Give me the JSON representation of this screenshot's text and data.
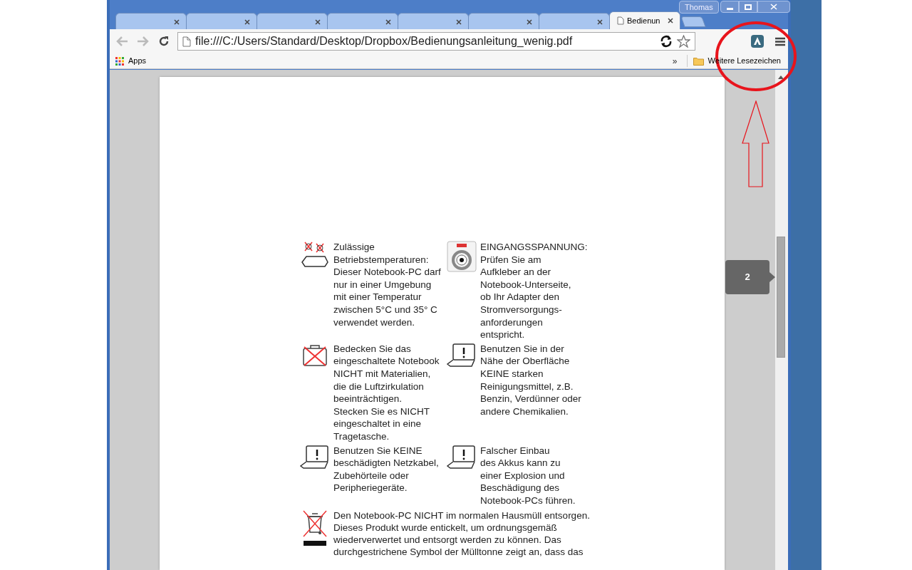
{
  "window": {
    "profile": "Thomas"
  },
  "tabs": [
    {
      "selected": false
    },
    {
      "selected": false
    },
    {
      "selected": false
    },
    {
      "selected": false
    },
    {
      "selected": false
    },
    {
      "selected": false
    },
    {
      "selected": false
    },
    {
      "title": "Bedienun",
      "selected": true
    }
  ],
  "address": "file:///C:/Users/Standard/Desktop/Dropbox/Bedienungsanleitung_wenig.pdf",
  "bookmarks": {
    "apps": "Apps",
    "overflow": "»",
    "other": "Weitere Lesezeichen"
  },
  "document": {
    "items": [
      {
        "kind": "temperature",
        "lines": [
          "Zulässige",
          "Betriebstemperaturen:",
          "Dieser Notebook-PC darf",
          "nur in einer Umgebung",
          "mit einer Temperatur",
          "zwischen 5°C und 35° C",
          "verwendet werden."
        ]
      },
      {
        "kind": "dcin",
        "lines": [
          "EINGANGSSPANNUNG:",
          "Prüfen Sie am",
          "Aufkleber an der",
          "Notebook-Unterseite,",
          "ob Ihr Adapter den",
          "Stromversorgungs-",
          "anforderungen",
          "entspricht."
        ]
      },
      {
        "kind": "bag",
        "lines": [
          "Bedecken Sie das",
          "eingeschaltete Notebook",
          "NICHT mit Materialien,",
          "die die Luftzirkulation",
          "beeinträchtigen.",
          "Stecken Sie es NICHT",
          "eingeschaltet in eine",
          "Tragetasche."
        ]
      },
      {
        "kind": "laptop",
        "lines": [
          "Benutzen Sie in der",
          "Nähe der Oberfläche",
          "KEINE starken",
          "Reinigungsmittel, z.B.",
          "Benzin, Verdünner oder",
          "andere Chemikalien."
        ]
      },
      {
        "kind": "laptop",
        "lines": [
          "Benutzen Sie KEINE",
          "beschädigten Netzkabel,",
          "Zubehörteile oder",
          "Peripheriegeräte."
        ]
      },
      {
        "kind": "laptop",
        "lines": [
          "Falscher Einbau",
          "des Akkus kann zu",
          "einer Explosion und",
          "Beschädigung des",
          "Notebook-PCs führen."
        ]
      },
      {
        "kind": "trash",
        "lines": [
          "Den Notebook-PC NICHT im normalen Hausmüll entsorgen.",
          "Dieses Produkt wurde entickelt, um ordnungsgemäß",
          "wiederverwertet und entsorgt werden zu können. Das",
          "durchgestrichene Symbol der Mülltonne zeigt an, dass das"
        ]
      }
    ]
  },
  "page_indicator": "2"
}
